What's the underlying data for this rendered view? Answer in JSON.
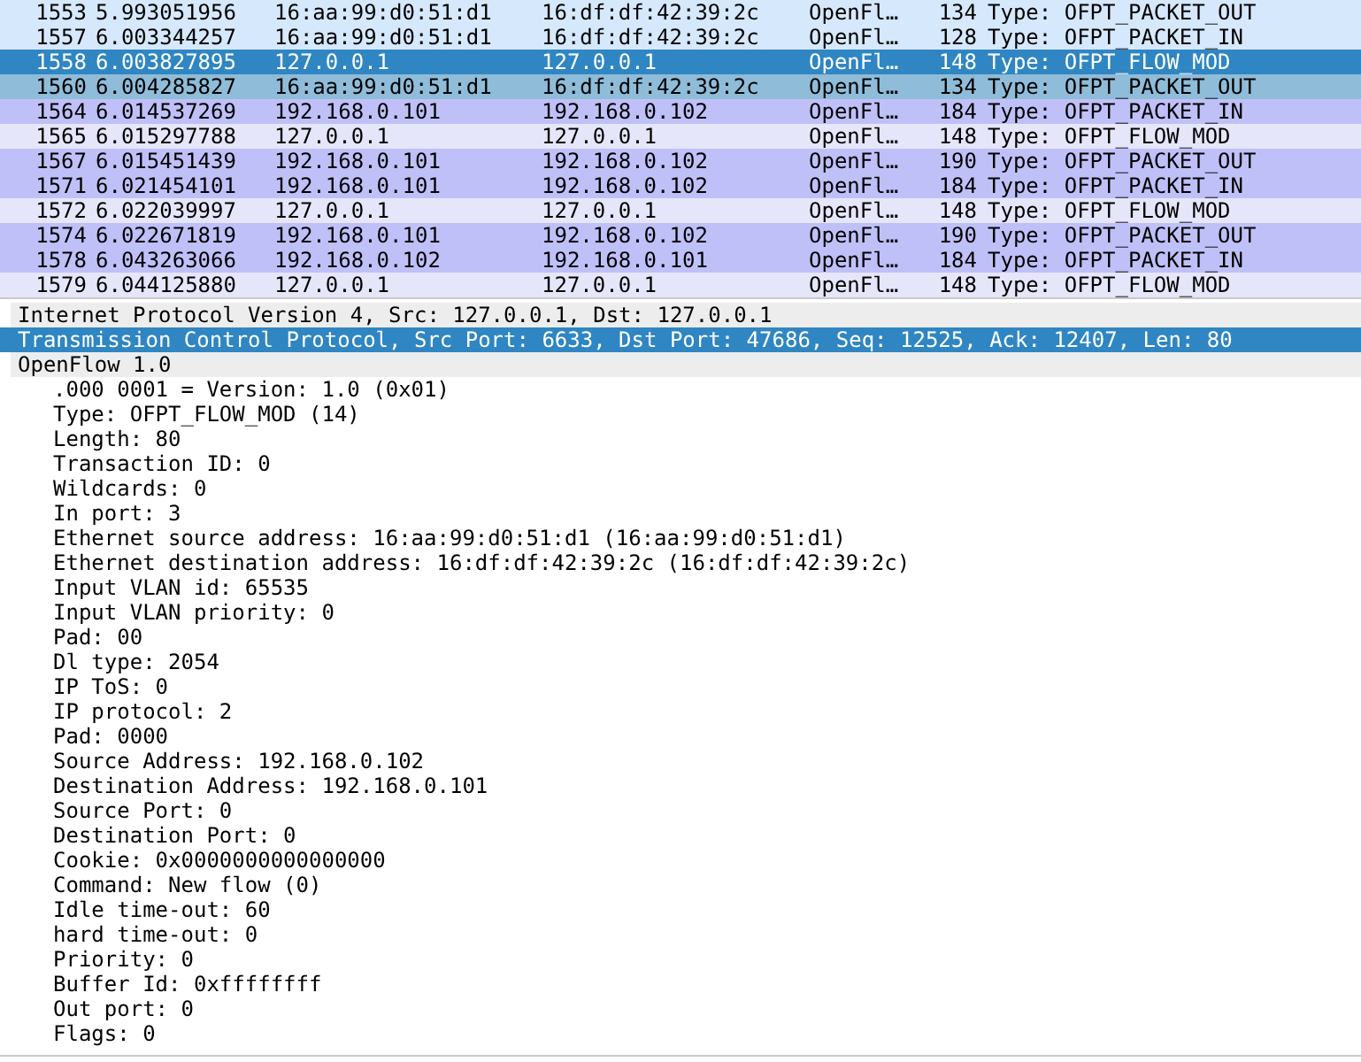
{
  "packet_list": {
    "rows": [
      {
        "number": "1553",
        "time": "5.993051956",
        "source": "16:aa:99:d0:51:d1",
        "destination": "16:df:df:42:39:2c",
        "protocol": "OpenFl…",
        "length": "134",
        "info": "Type: OFPT_PACKET_OUT",
        "color": "#d6e8fb",
        "selected": false
      },
      {
        "number": "1557",
        "time": "6.003344257",
        "source": "16:aa:99:d0:51:d1",
        "destination": "16:df:df:42:39:2c",
        "protocol": "OpenFl…",
        "length": "128",
        "info": "Type: OFPT_PACKET_IN",
        "color": "#d6e8fb",
        "selected": false
      },
      {
        "number": "1558",
        "time": "6.003827895",
        "source": "127.0.0.1",
        "destination": "127.0.0.1",
        "protocol": "OpenFl…",
        "length": "148",
        "info": "Type: OFPT_FLOW_MOD",
        "selected": true
      },
      {
        "number": "1560",
        "time": "6.004285827",
        "source": "16:aa:99:d0:51:d1",
        "destination": "16:df:df:42:39:2c",
        "protocol": "OpenFl…",
        "length": "134",
        "info": "Type: OFPT_PACKET_OUT",
        "color": "#8fbcd8",
        "selected": false
      },
      {
        "number": "1564",
        "time": "6.014537269",
        "source": "192.168.0.101",
        "destination": "192.168.0.102",
        "protocol": "OpenFl…",
        "length": "184",
        "info": "Type: OFPT_PACKET_IN",
        "color": "#c0c0f8",
        "selected": false
      },
      {
        "number": "1565",
        "time": "6.015297788",
        "source": "127.0.0.1",
        "destination": "127.0.0.1",
        "protocol": "OpenFl…",
        "length": "148",
        "info": "Type: OFPT_FLOW_MOD",
        "color": "#e6e6fa",
        "selected": false
      },
      {
        "number": "1567",
        "time": "6.015451439",
        "source": "192.168.0.101",
        "destination": "192.168.0.102",
        "protocol": "OpenFl…",
        "length": "190",
        "info": "Type: OFPT_PACKET_OUT",
        "color": "#c0c0f8",
        "selected": false
      },
      {
        "number": "1571",
        "time": "6.021454101",
        "source": "192.168.0.101",
        "destination": "192.168.0.102",
        "protocol": "OpenFl…",
        "length": "184",
        "info": "Type: OFPT_PACKET_IN",
        "color": "#c0c0f8",
        "selected": false
      },
      {
        "number": "1572",
        "time": "6.022039997",
        "source": "127.0.0.1",
        "destination": "127.0.0.1",
        "protocol": "OpenFl…",
        "length": "148",
        "info": "Type: OFPT_FLOW_MOD",
        "color": "#e6e6fa",
        "selected": false
      },
      {
        "number": "1574",
        "time": "6.022671819",
        "source": "192.168.0.101",
        "destination": "192.168.0.102",
        "protocol": "OpenFl…",
        "length": "190",
        "info": "Type: OFPT_PACKET_OUT",
        "color": "#c0c0f8",
        "selected": false
      },
      {
        "number": "1578",
        "time": "6.043263066",
        "source": "192.168.0.102",
        "destination": "192.168.0.101",
        "protocol": "OpenFl…",
        "length": "184",
        "info": "Type: OFPT_PACKET_IN",
        "color": "#c0c0f8",
        "selected": false
      },
      {
        "number": "1579",
        "time": "6.044125880",
        "source": "127.0.0.1",
        "destination": "127.0.0.1",
        "protocol": "OpenFl…",
        "length": "148",
        "info": "Type: OFPT_FLOW_MOD",
        "color": "#e6e6fa",
        "selected": false
      }
    ]
  },
  "packet_details": {
    "items": [
      {
        "label": "Internet Protocol Version 4, Src: 127.0.0.1, Dst: 127.0.0.1",
        "selected": false
      },
      {
        "label": "Transmission Control Protocol, Src Port: 6633, Dst Port: 47686, Seq: 12525, Ack: 12407, Len: 80",
        "selected": true
      },
      {
        "label": "OpenFlow 1.0",
        "selected": false,
        "children": [
          {
            "label": ".000 0001 = Version: 1.0 (0x01)",
            "selected": false
          },
          {
            "label": "Type: OFPT_FLOW_MOD (14)",
            "selected": false
          },
          {
            "label": "Length: 80",
            "selected": false
          },
          {
            "label": "Transaction ID: 0",
            "selected": false
          },
          {
            "label": "Wildcards: 0",
            "selected": false
          },
          {
            "label": "In port: 3",
            "selected": false
          },
          {
            "label": "Ethernet source address: 16:aa:99:d0:51:d1 (16:aa:99:d0:51:d1)",
            "selected": false
          },
          {
            "label": "Ethernet destination address: 16:df:df:42:39:2c (16:df:df:42:39:2c)",
            "selected": false
          },
          {
            "label": "Input VLAN id: 65535",
            "selected": false
          },
          {
            "label": "Input VLAN priority: 0",
            "selected": false
          },
          {
            "label": "Pad: 00",
            "selected": false
          },
          {
            "label": "Dl type: 2054",
            "selected": false
          },
          {
            "label": "IP ToS: 0",
            "selected": false
          },
          {
            "label": "IP protocol: 2",
            "selected": false
          },
          {
            "label": "Pad: 0000",
            "selected": false
          },
          {
            "label": "Source Address: 192.168.0.102",
            "selected": false
          },
          {
            "label": "Destination Address: 192.168.0.101",
            "selected": false
          },
          {
            "label": "Source Port: 0",
            "selected": false
          },
          {
            "label": "Destination Port: 0",
            "selected": false
          },
          {
            "label": "Cookie: 0x0000000000000000",
            "selected": false
          },
          {
            "label": "Command: New flow (0)",
            "selected": false
          },
          {
            "label": "Idle time-out: 60",
            "selected": false
          },
          {
            "label": "hard time-out: 0",
            "selected": false
          },
          {
            "label": "Priority: 0",
            "selected": false
          },
          {
            "label": "Buffer Id: 0xffffffff",
            "selected": false
          },
          {
            "label": "Out port: 0",
            "selected": false
          },
          {
            "label": "Flags: 0",
            "selected": false
          }
        ]
      }
    ]
  }
}
